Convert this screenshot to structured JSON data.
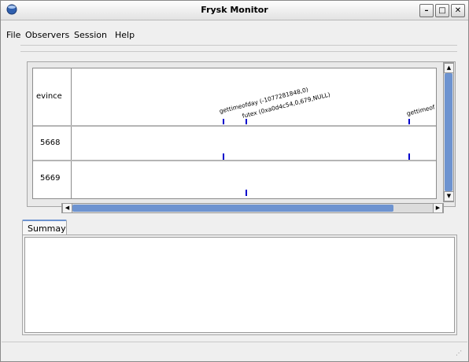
{
  "window": {
    "title": "Frysk Monitor"
  },
  "menu": {
    "file": "File",
    "observers": "Observers",
    "session": "Session",
    "help": "Help"
  },
  "timeline": {
    "rows": [
      {
        "label": "evince"
      },
      {
        "label": "5668"
      },
      {
        "label": "5669"
      }
    ],
    "events": [
      {
        "label": "gettimeofday (-1077281848,0)"
      },
      {
        "label": "futex (0xa0d4c54,0,679,NULL)"
      },
      {
        "label": "gettimeof"
      }
    ]
  },
  "summary_tab": {
    "label": "Summay"
  },
  "colors": {
    "tick": "#0000cc",
    "scroll_thumb": "#6d93d0"
  }
}
